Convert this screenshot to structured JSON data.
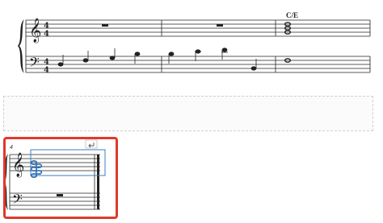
{
  "score": {
    "chord_symbol": "C/E",
    "measure_number": "4",
    "time_signature_top": "4",
    "time_signature_bottom": "4"
  },
  "icons": {
    "insert_tool": "return-arrow-icon"
  },
  "colors": {
    "staff": "#222222",
    "selection_border": "#e0392b",
    "selection_rect": "#3b7fc4",
    "selected_notes": "#2c6db3"
  }
}
